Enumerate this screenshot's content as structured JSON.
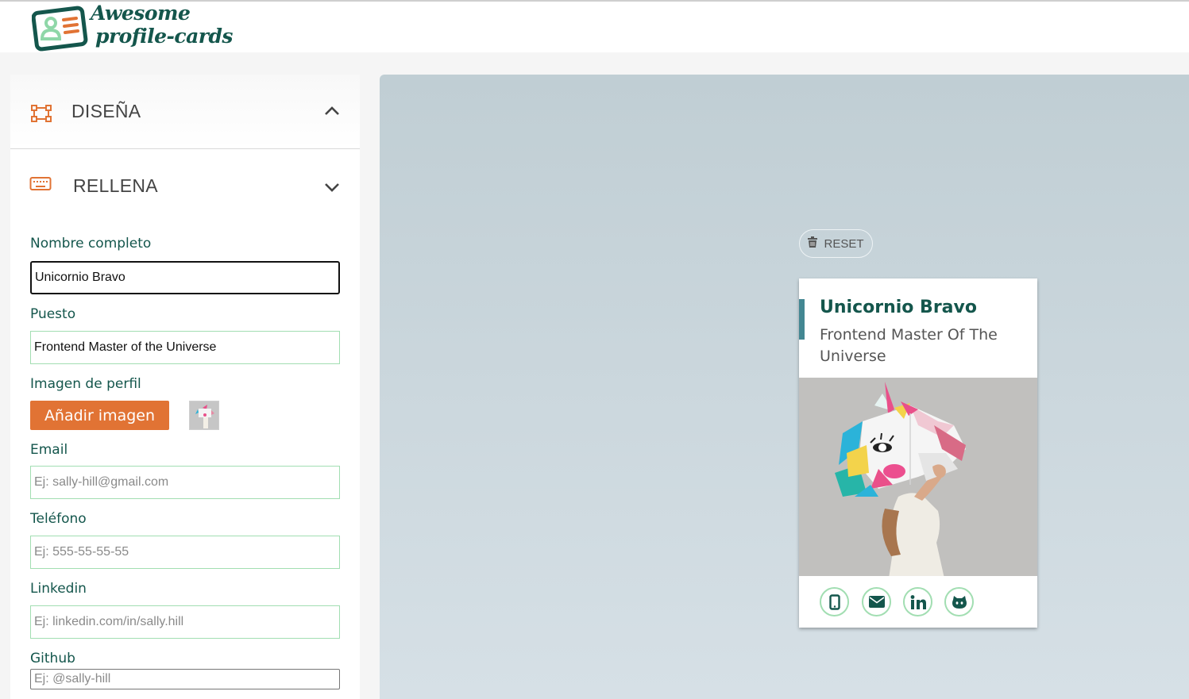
{
  "logo": {
    "line1": "Awesome",
    "line2": "profile-cards"
  },
  "accordion": {
    "design_label": "DISEÑA",
    "fill_label": "RELLENA"
  },
  "form": {
    "name_label": "Nombre completo",
    "name_value": "Unicornio Bravo",
    "job_label": "Puesto",
    "job_value": "Frontend Master of the Universe",
    "image_label": "Imagen de perfil",
    "add_image_button": "Añadir imagen",
    "email_label": "Email",
    "email_placeholder": "Ej: sally-hill@gmail.com",
    "phone_label": "Teléfono",
    "phone_placeholder": "Ej: 555-55-55-55",
    "linkedin_label": "Linkedin",
    "linkedin_placeholder": "Ej: linkedin.com/in/sally.hill",
    "github_label": "Github",
    "github_placeholder": "Ej: @sally-hill"
  },
  "preview": {
    "reset_label": "RESET",
    "card_name": "Unicornio Bravo",
    "card_job": "Frontend Master Of The Universe",
    "social_icons": [
      "mobile-icon",
      "envelope-icon",
      "linkedin-icon",
      "github-icon"
    ]
  },
  "colors": {
    "brand_green": "#14564c",
    "accent_orange": "#e17334",
    "field_border": "#a2deb2",
    "card_bar": "#438792"
  }
}
